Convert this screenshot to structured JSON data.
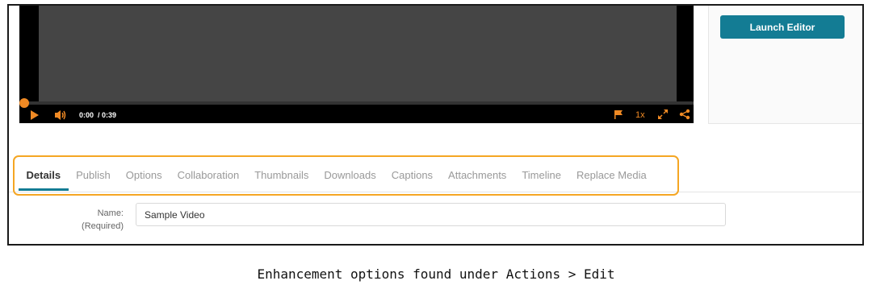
{
  "player": {
    "time_display": "0:00  / 0:39",
    "speed_label": "1x",
    "accent_color": "#f08a24",
    "progress": 0.0,
    "icons": [
      "play-icon",
      "volume-icon",
      "flag-icon",
      "fullscreen-icon",
      "share-icon"
    ]
  },
  "side_panel": {
    "launch_editor_label": "Launch Editor",
    "button_color": "#137c94"
  },
  "tabs": [
    {
      "label": "Details",
      "active": true
    },
    {
      "label": "Publish",
      "active": false
    },
    {
      "label": "Options",
      "active": false
    },
    {
      "label": "Collaboration",
      "active": false
    },
    {
      "label": "Thumbnails",
      "active": false
    },
    {
      "label": "Downloads",
      "active": false
    },
    {
      "label": "Captions",
      "active": false
    },
    {
      "label": "Attachments",
      "active": false
    },
    {
      "label": "Timeline",
      "active": false
    },
    {
      "label": "Replace Media",
      "active": false
    }
  ],
  "form": {
    "name_label": "Name:",
    "name_required": "(Required)",
    "name_value": "Sample Video"
  },
  "caption": "Enhancement options found under Actions > Edit",
  "highlight_color": "#f5a623"
}
